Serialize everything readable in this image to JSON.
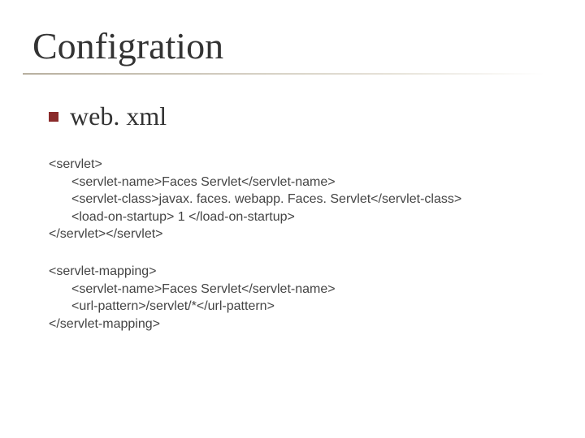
{
  "title": "Configration",
  "subheading": "web. xml",
  "block1": {
    "line1": "<servlet>",
    "line2": "<servlet-name>Faces Servlet</servlet-name>",
    "line3": "<servlet-class>javax. faces. webapp. Faces. Servlet</servlet-class>",
    "line4": "<load-on-startup> 1 </load-on-startup>",
    "line5": "</servlet></servlet>"
  },
  "block2": {
    "line1": "<servlet-mapping>",
    "line2": "<servlet-name>Faces Servlet</servlet-name>",
    "line3": "<url-pattern>/servlet/*</url-pattern>",
    "line4": "</servlet-mapping>"
  }
}
